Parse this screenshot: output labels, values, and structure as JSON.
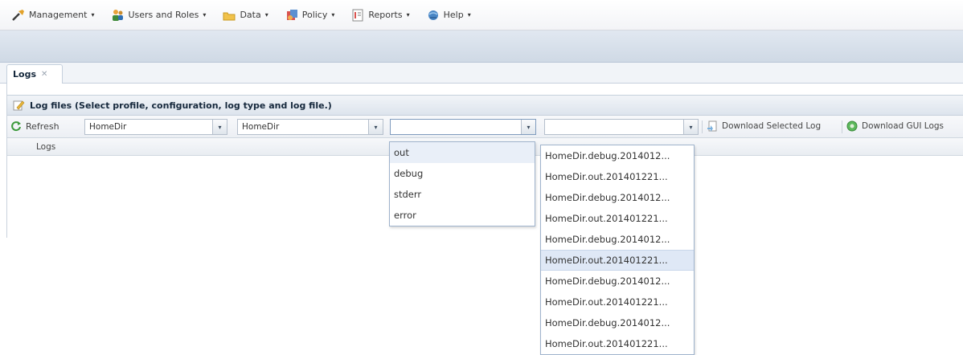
{
  "menubar": {
    "items": [
      {
        "label": "Management",
        "icon": "wrench-icon"
      },
      {
        "label": "Users and Roles",
        "icon": "users-icon"
      },
      {
        "label": "Data",
        "icon": "data-folder-icon"
      },
      {
        "label": "Policy",
        "icon": "policy-icon"
      },
      {
        "label": "Reports",
        "icon": "reports-icon"
      },
      {
        "label": "Help",
        "icon": "help-globe-icon"
      }
    ],
    "caret": "▾"
  },
  "tabs": [
    {
      "label": "Logs",
      "close": "✕"
    }
  ],
  "panel": {
    "title": "Log files (Select profile, configuration, log type and log file.)"
  },
  "toolbar": {
    "refresh_label": "Refresh",
    "profile_value": "HomeDir",
    "configuration_value": "HomeDir",
    "logtype_value": "",
    "logfile_value": "",
    "download_selected_label": "Download Selected Log",
    "download_gui_label": "Download GUI Logs",
    "trigger": "▾"
  },
  "grid": {
    "column_header": "Logs"
  },
  "logtype_dropdown": {
    "options": [
      "out",
      "debug",
      "stderr",
      "error"
    ],
    "selected_index": 0
  },
  "logfile_dropdown": {
    "options": [
      "HomeDir.debug.2014012...",
      "HomeDir.out.201401221...",
      "HomeDir.debug.2014012...",
      "HomeDir.out.201401221...",
      "HomeDir.debug.2014012...",
      "HomeDir.out.201401221...",
      "HomeDir.debug.2014012...",
      "HomeDir.out.201401221...",
      "HomeDir.debug.2014012...",
      "HomeDir.out.201401221..."
    ],
    "highlighted_index": 5
  },
  "colors": {
    "accent": "#15283c",
    "band": "#d6dfea",
    "highlight": "#dfe8f6"
  }
}
